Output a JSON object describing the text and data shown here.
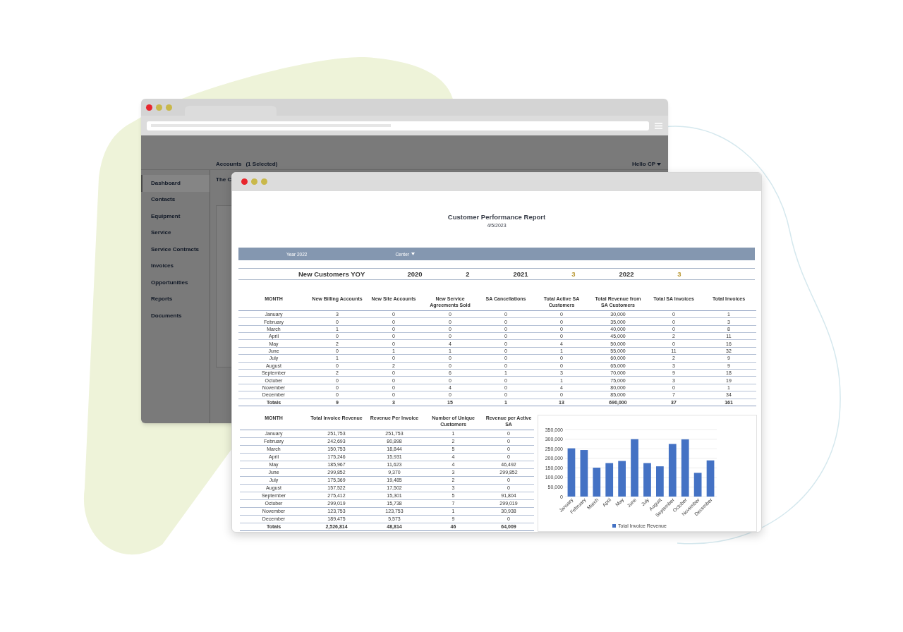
{
  "back_window": {
    "top_bar": {
      "accounts": "Accounts",
      "selection": "(1 Selected)",
      "user": "Hello CP"
    },
    "sidebar": {
      "items": [
        {
          "label": "Dashboard",
          "selected": true
        },
        {
          "label": "Contacts",
          "selected": false
        },
        {
          "label": "Equipment",
          "selected": false
        },
        {
          "label": "Service",
          "selected": false
        },
        {
          "label": "Service Contracts",
          "selected": false
        },
        {
          "label": "Invoices",
          "selected": false
        },
        {
          "label": "Opportunities",
          "selected": false
        },
        {
          "label": "Reports",
          "selected": false
        },
        {
          "label": "Documents",
          "selected": false
        }
      ]
    },
    "page_heading": "The C"
  },
  "report": {
    "title": "Customer Performance Report",
    "date": "4/5/2023",
    "filters": [
      {
        "label": "Year 2022",
        "kind": "text"
      },
      {
        "label": "Center",
        "kind": "dropdown"
      }
    ],
    "yoy": {
      "label": "New Customers YOY",
      "entries": [
        {
          "year": "2020",
          "value": "2",
          "color": "#333333"
        },
        {
          "year": "2021",
          "value": "3",
          "color": "#b8962e"
        },
        {
          "year": "2022",
          "value": "3",
          "color": "#b8962e"
        }
      ]
    },
    "table_1": {
      "columns": [
        "MONTH",
        "New Billing Accounts",
        "New Site Accounts",
        "New Service Agreements Sold",
        "SA Cancellations",
        "Total Active SA Customers",
        "Total Revenue from SA Customers",
        "Total SA Invoices",
        "Total Invoices"
      ],
      "rows": [
        [
          "January",
          "3",
          "0",
          "0",
          "0",
          "0",
          "30,000",
          "0",
          "1"
        ],
        [
          "February",
          "0",
          "0",
          "0",
          "0",
          "0",
          "35,000",
          "0",
          "3"
        ],
        [
          "March",
          "1",
          "0",
          "0",
          "0",
          "0",
          "40,000",
          "0",
          "8"
        ],
        [
          "April",
          "0",
          "0",
          "0",
          "0",
          "0",
          "45,000",
          "2",
          "11"
        ],
        [
          "May",
          "2",
          "0",
          "4",
          "0",
          "4",
          "50,000",
          "0",
          "16"
        ],
        [
          "June",
          "0",
          "1",
          "1",
          "0",
          "1",
          "55,000",
          "11",
          "32"
        ],
        [
          "July",
          "1",
          "0",
          "0",
          "0",
          "0",
          "60,000",
          "2",
          "9"
        ],
        [
          "August",
          "0",
          "2",
          "0",
          "0",
          "0",
          "65,000",
          "3",
          "9"
        ],
        [
          "September",
          "2",
          "0",
          "6",
          "1",
          "3",
          "70,000",
          "9",
          "18"
        ],
        [
          "October",
          "0",
          "0",
          "0",
          "0",
          "1",
          "75,000",
          "3",
          "19"
        ],
        [
          "November",
          "0",
          "0",
          "4",
          "0",
          "4",
          "80,000",
          "0",
          "1"
        ],
        [
          "December",
          "0",
          "0",
          "0",
          "0",
          "0",
          "85,000",
          "7",
          "34"
        ]
      ],
      "totals": [
        "Totals",
        "9",
        "3",
        "15",
        "1",
        "13",
        "690,000",
        "37",
        "161"
      ]
    },
    "table_2": {
      "columns": [
        "MONTH",
        "Total Invoice Revenue",
        "Revenue Per Invoice",
        "Number of Unique Customers",
        "Revenue per Active SA"
      ],
      "rows": [
        [
          "January",
          "251,753",
          "251,753",
          "1",
          "0"
        ],
        [
          "February",
          "242,693",
          "80,898",
          "2",
          "0"
        ],
        [
          "March",
          "150,753",
          "18,844",
          "5",
          "0"
        ],
        [
          "April",
          "175,246",
          "15,931",
          "4",
          "0"
        ],
        [
          "May",
          "185,967",
          "11,623",
          "4",
          "46,492"
        ],
        [
          "June",
          "299,852",
          "9,370",
          "3",
          "299,852"
        ],
        [
          "July",
          "175,369",
          "19,485",
          "2",
          "0"
        ],
        [
          "August",
          "157,522",
          "17,502",
          "3",
          "0"
        ],
        [
          "September",
          "275,412",
          "15,301",
          "5",
          "91,804"
        ],
        [
          "October",
          "299,019",
          "15,738",
          "7",
          "299,019"
        ],
        [
          "November",
          "123,753",
          "123,753",
          "1",
          "30,938"
        ],
        [
          "December",
          "189,475",
          "5,573",
          "9",
          "0"
        ]
      ],
      "totals": [
        "Totals",
        "2,526,814",
        "48,814",
        "46",
        "64,009"
      ]
    },
    "chart_data": {
      "type": "bar",
      "categories": [
        "January",
        "February",
        "March",
        "April",
        "May",
        "June",
        "July",
        "August",
        "September",
        "October",
        "November",
        "December"
      ],
      "series": [
        {
          "name": "Total Invoice Revenue",
          "color": "#4472c4",
          "values": [
            252000,
            243000,
            151000,
            175000,
            186000,
            300000,
            175000,
            158000,
            275000,
            299000,
            124000,
            189000
          ]
        }
      ],
      "ylim": [
        0,
        350000
      ],
      "grid": true,
      "yticks": [
        {
          "value": 0,
          "label": "0"
        },
        {
          "value": 50000,
          "label": "50,000"
        },
        {
          "value": 100000,
          "label": "100,000"
        },
        {
          "value": 150000,
          "label": "150,000"
        },
        {
          "value": 200000,
          "label": "200,000"
        },
        {
          "value": 250000,
          "label": "250,000"
        },
        {
          "value": 300000,
          "label": "300,000"
        },
        {
          "value": 350000,
          "label": "350,000"
        }
      ]
    }
  }
}
